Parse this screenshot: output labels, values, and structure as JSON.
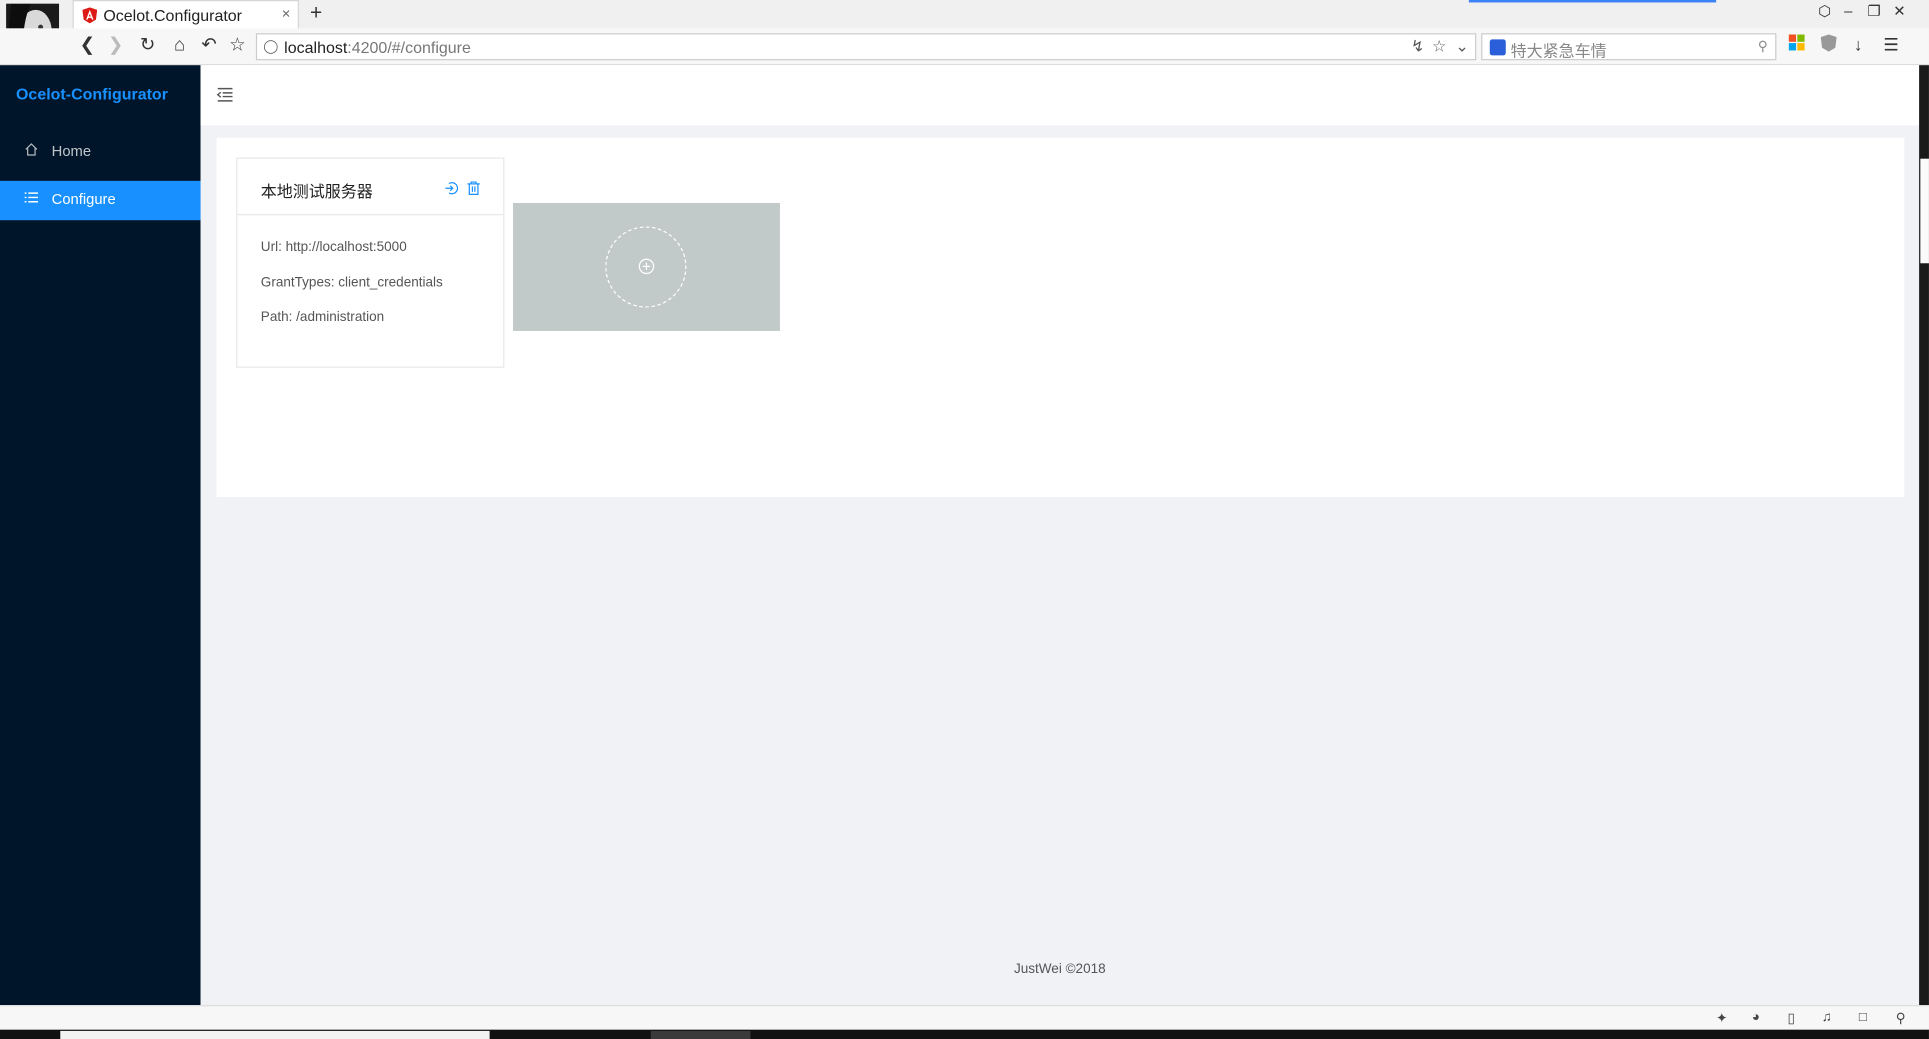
{
  "browser": {
    "tab_title": "Ocelot.Configurator",
    "new_tab": "+",
    "tab_close": "×",
    "url_host": "localhost",
    "url_path": ":4200/#/configure",
    "search_placeholder": "特大紧急车情",
    "window_controls": [
      "⬡",
      "–",
      "❐",
      "✕"
    ]
  },
  "sidebar": {
    "logo": "Ocelot-Configurator",
    "items": [
      {
        "label": "Home",
        "icon": "home-icon",
        "active": false
      },
      {
        "label": "Configure",
        "icon": "list-icon",
        "active": true
      }
    ]
  },
  "server_card": {
    "title": "本地测试服务器",
    "url": "Url: http://localhost:5000",
    "grant_types": "GrantTypes: client_credentials",
    "path": "Path: /administration"
  },
  "footer": {
    "text": "JustWei ©2018"
  },
  "colors": {
    "sider_bg": "#001529",
    "accent": "#1890ff",
    "add_tile": "#c1c9c9"
  }
}
